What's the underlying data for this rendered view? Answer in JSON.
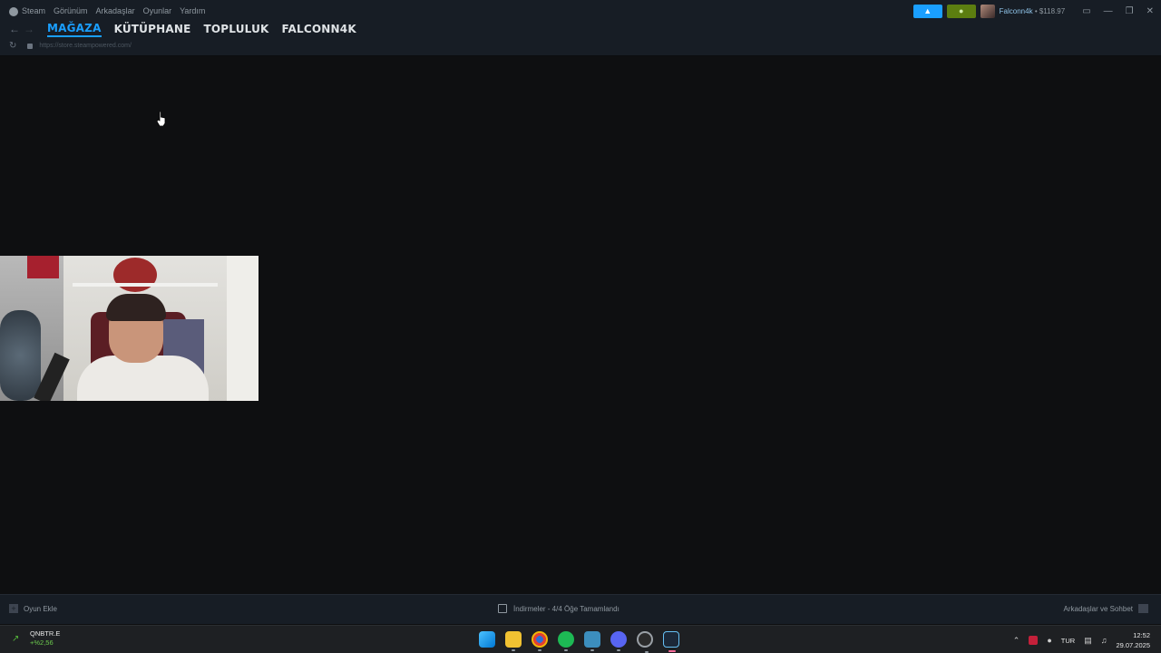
{
  "menu": {
    "items": [
      "Steam",
      "Görünüm",
      "Arkadaşlar",
      "Oyunlar",
      "Yardım"
    ]
  },
  "nav": {
    "back_icon": "arrow-left-icon",
    "forward_icon": "arrow-right-icon",
    "tabs": [
      {
        "label": "MAĞAZA",
        "active": true
      },
      {
        "label": "KÜTÜPHANE",
        "active": false
      },
      {
        "label": "TOPLULUK",
        "active": false
      },
      {
        "label": "FALCONN4K",
        "active": false
      }
    ]
  },
  "url": {
    "address": "https://store.steampowered.com/"
  },
  "account": {
    "name": "Falconn4k",
    "separator": "•",
    "balance": "$118.97"
  },
  "colors": {
    "accent": "#1a9fff",
    "notify_green": "#5c7e10",
    "titlebar": "#171d25",
    "content_bg": "#0e0f11"
  },
  "bottom": {
    "add_game": "Oyun Ekle",
    "downloads": "İndirmeler - 4/4 Öğe Tamamlandı",
    "friends": "Arkadaşlar ve Sohbet"
  },
  "taskbar": {
    "stock_symbol": "QNBTR.E",
    "stock_change": "+%2,56",
    "apps": [
      "windows-start-icon",
      "file-explorer-icon",
      "chrome-icon",
      "spotify-icon",
      "app-icon",
      "discord-icon",
      "obs-icon",
      "steam-icon"
    ],
    "language": "TUR",
    "time": "12:52",
    "date": "29.07.2025"
  }
}
